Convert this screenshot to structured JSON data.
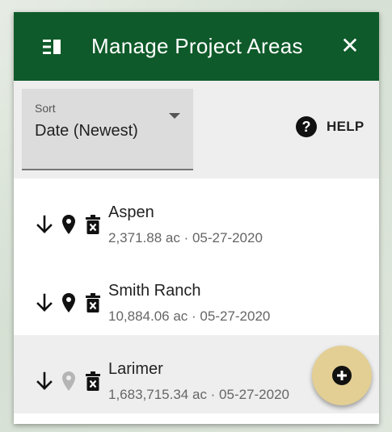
{
  "header": {
    "title": "Manage Project Areas",
    "close_label": "✕",
    "color": "#0f5a2a"
  },
  "toolbar": {
    "sort": {
      "label": "Sort",
      "value": "Date (Newest)"
    },
    "help_label": "HELP"
  },
  "areas": [
    {
      "name": "Aspen",
      "meta": "2,371.88 ac · 05-27-2020",
      "pin_active": true,
      "selected": false
    },
    {
      "name": "Smith Ranch",
      "meta": "10,884.06 ac · 05-27-2020",
      "pin_active": true,
      "selected": false
    },
    {
      "name": "Larimer",
      "meta": "1,683,715.34 ac · 05-27-2020",
      "pin_active": false,
      "selected": true
    }
  ],
  "fab": {
    "icon": "plus-circle-icon",
    "color": "#e3cf93"
  }
}
